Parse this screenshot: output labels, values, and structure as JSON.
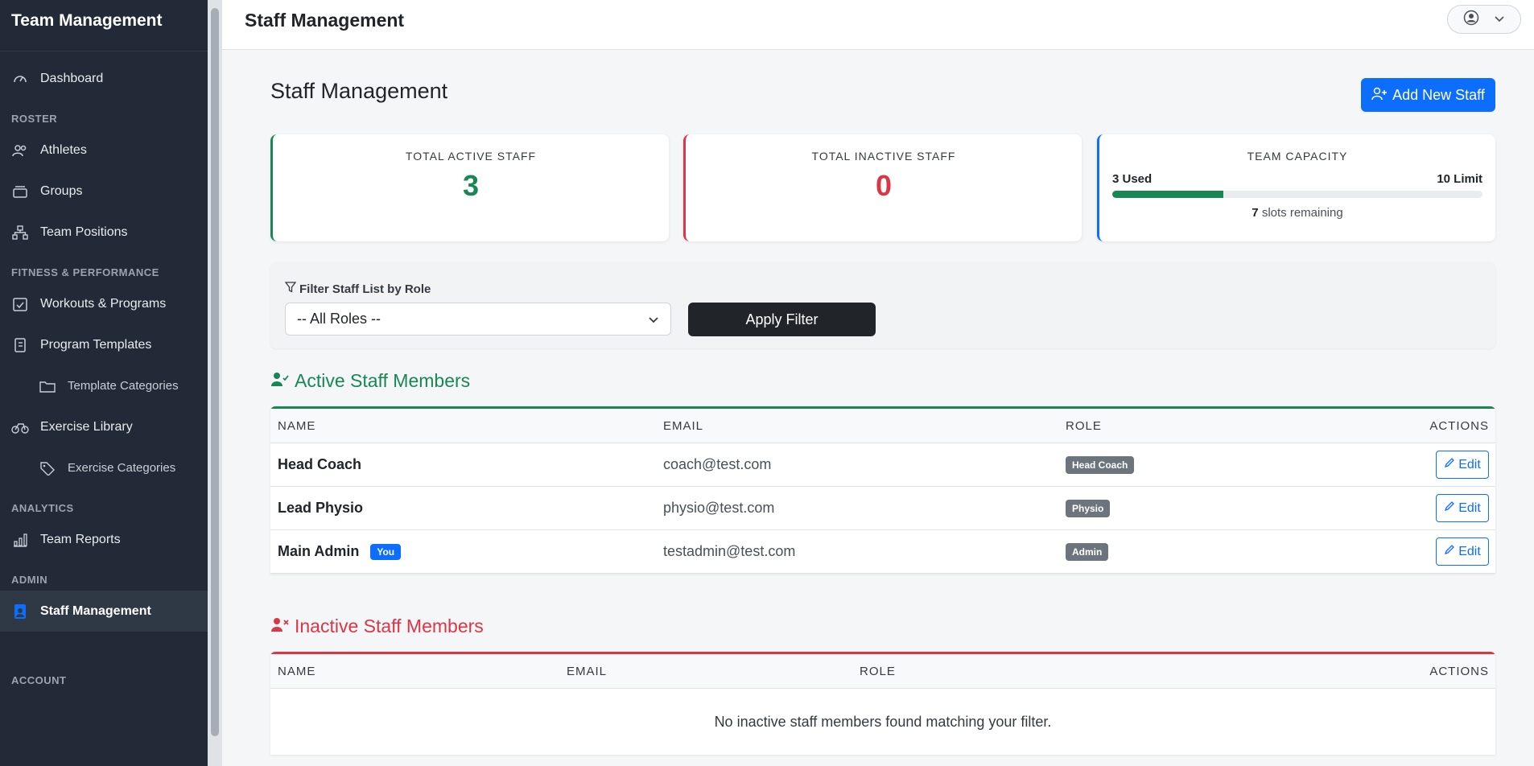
{
  "sidebar": {
    "brand": "Team Management",
    "items": {
      "dashboard": "Dashboard",
      "athletes": "Athletes",
      "groups": "Groups",
      "team_positions": "Team Positions",
      "workouts": "Workouts & Programs",
      "program_templates": "Program Templates",
      "template_categories": "Template Categories",
      "exercise_library": "Exercise Library",
      "exercise_categories": "Exercise Categories",
      "team_reports": "Team Reports",
      "staff_management": "Staff Management"
    },
    "sections": {
      "roster": "ROSTER",
      "fitness": "FITNESS & PERFORMANCE",
      "analytics": "ANALYTICS",
      "admin": "ADMIN",
      "account": "ACCOUNT"
    }
  },
  "header": {
    "title": "Staff Management"
  },
  "main": {
    "title": "Staff Management",
    "add_button": "Add New Staff",
    "stats": {
      "active_label": "TOTAL ACTIVE STAFF",
      "active_value": "3",
      "inactive_label": "TOTAL INACTIVE STAFF",
      "inactive_value": "0",
      "capacity_label": "TEAM CAPACITY",
      "used": "3 Used",
      "limit": "10 Limit",
      "used_fraction": 0.3,
      "remaining_count": "7",
      "remaining_text": "slots remaining"
    },
    "filter": {
      "label": "Filter Staff List by Role",
      "selected": "-- All Roles --",
      "button": "Apply Filter"
    },
    "active_section": {
      "title": "Active Staff Members",
      "columns": [
        "NAME",
        "EMAIL",
        "ROLE",
        "ACTIONS"
      ],
      "rows": [
        {
          "name": "Head Coach",
          "email": "coach@test.com",
          "role": "Head Coach",
          "action": "Edit"
        },
        {
          "name": "Lead Physio",
          "email": "physio@test.com",
          "role": "Physio",
          "action": "Edit"
        },
        {
          "name": "Main Admin",
          "you": "You",
          "email": "testadmin@test.com",
          "role": "Admin",
          "action": "Edit"
        }
      ]
    },
    "inactive_section": {
      "title": "Inactive Staff Members",
      "columns": [
        "NAME",
        "EMAIL",
        "ROLE",
        "ACTIONS"
      ],
      "empty": "No inactive staff members found matching your filter."
    }
  }
}
